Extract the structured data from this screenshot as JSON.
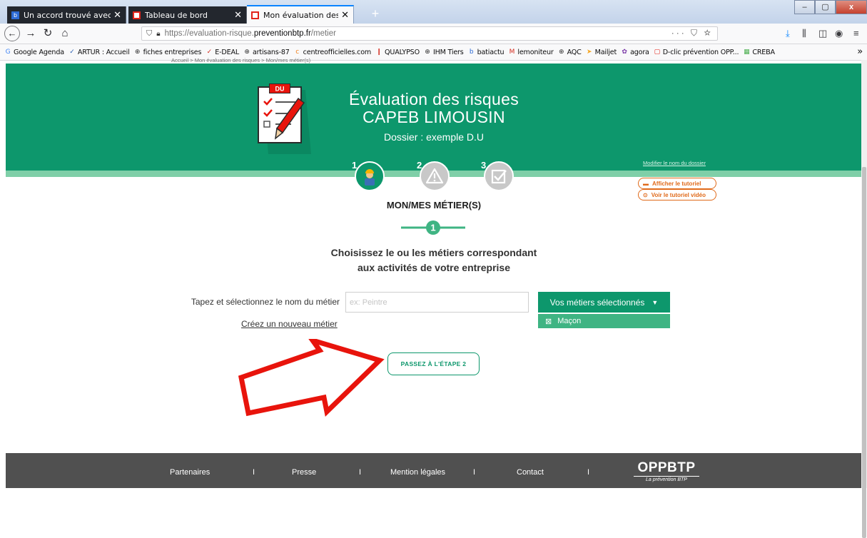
{
  "browser": {
    "tabs": [
      {
        "label": "Un accord trouvé avec l'Etat po",
        "favicon_color": "#2d6bd6",
        "favicon_text": "b",
        "active": false
      },
      {
        "label": "Tableau de bord",
        "favicon_color": "#e2231a",
        "favicon_text": "",
        "active": false
      },
      {
        "label": "Mon évaluation des risques",
        "favicon_color": "#e2231a",
        "favicon_text": "",
        "active": true
      }
    ],
    "new_tab_label": "+",
    "close_glyph": "✕",
    "url_prefix": "https://evaluation-risque.",
    "url_host": "preventionbtp.fr",
    "url_path": "/metier",
    "url_actions": "··· ⛉ ☆",
    "window_controls": [
      "–",
      "▢",
      "x"
    ]
  },
  "bookmarks": [
    {
      "label": "Google Agenda",
      "icon": "google-icon",
      "glyph": "G",
      "color": "#4285f4"
    },
    {
      "label": "ARTUR : Accueil",
      "icon": "hammer-icon",
      "glyph": "✓",
      "color": "#2b5fb3"
    },
    {
      "label": "fiches entreprises",
      "icon": "globe-icon",
      "glyph": "⊕",
      "color": "#333333"
    },
    {
      "label": "E-DEAL",
      "icon": "edeal-icon",
      "glyph": "✓",
      "color": "#d42b1e"
    },
    {
      "label": "artisans-87",
      "icon": "globe-icon",
      "glyph": "⊕",
      "color": "#333333"
    },
    {
      "label": "centreofficielles.com",
      "icon": "centre-icon",
      "glyph": "c",
      "color": "#f07f1d"
    },
    {
      "label": "QUALYPSO",
      "icon": "qualypso-icon",
      "glyph": "❙",
      "color": "#d42b1e"
    },
    {
      "label": "IHM Tiers",
      "icon": "globe-icon",
      "glyph": "⊕",
      "color": "#333333"
    },
    {
      "label": "batiactu",
      "icon": "batiactu-icon",
      "glyph": "b",
      "color": "#2d6bd6"
    },
    {
      "label": "lemoniteur",
      "icon": "lemoniteur-icon",
      "glyph": "M",
      "color": "#d42b1e"
    },
    {
      "label": "AQC",
      "icon": "globe-icon",
      "glyph": "⊕",
      "color": "#333333"
    },
    {
      "label": "Mailjet",
      "icon": "mailjet-icon",
      "glyph": "➤",
      "color": "#f5a623"
    },
    {
      "label": "agora",
      "icon": "agora-icon",
      "glyph": "✿",
      "color": "#7c3aa8"
    },
    {
      "label": "D-clic prévention OPP...",
      "icon": "dclic-icon",
      "glyph": "▢",
      "color": "#e2231a"
    },
    {
      "label": "CREBA",
      "icon": "creba-icon",
      "glyph": "▦",
      "color": "#4caf50"
    }
  ],
  "page": {
    "breadcrumb": "Accueil  >  Mon évaluation des risques  >  Mon/mes métier(s)",
    "hero": {
      "title_line1": "Évaluation des risques",
      "title_line2": "CAPEB LIMOUSIN",
      "dossier": "Dossier : exemple D.U",
      "doc_badge": "DU",
      "rename_link": "Modifier le nom du dossier"
    },
    "steps": [
      {
        "number": "1",
        "icon": "worker-icon"
      },
      {
        "number": "2",
        "icon": "warning-icon"
      },
      {
        "number": "3",
        "icon": "checkbox-icon"
      }
    ],
    "tutorials": {
      "show_tutorial": "Afficher le tutoriel",
      "video_tutorial": "Voir le tutoriel vidéo"
    },
    "section_title": "MON/MES MÉTIER(S)",
    "step_indicator": "1",
    "instructions_line1": "Choisissez le ou les métiers correspondant",
    "instructions_line2": "aux activités de votre entreprise",
    "field_label": "Tapez et sélectionnez le nom du métier",
    "search_placeholder": "ex: Peintre",
    "search_value": "",
    "create_link": "Créez un nouveau métier",
    "selected_button": "Vos métiers sélectionnés",
    "selected_items": [
      "Maçon"
    ],
    "next_button": "PASSEZ À L'ÉTAPE 2"
  },
  "footer": {
    "links": [
      "Partenaires",
      "Presse",
      "Mention légales",
      "Contact"
    ],
    "separator": "I",
    "logo_text": "OPPBTP",
    "logo_sub": "La prévention BTP"
  },
  "colors": {
    "brand_green": "#0d976c",
    "light_green": "#7fcfa8",
    "orange": "#e06a1a",
    "arrow_red": "#e8140c",
    "footer_gray": "#505050"
  }
}
